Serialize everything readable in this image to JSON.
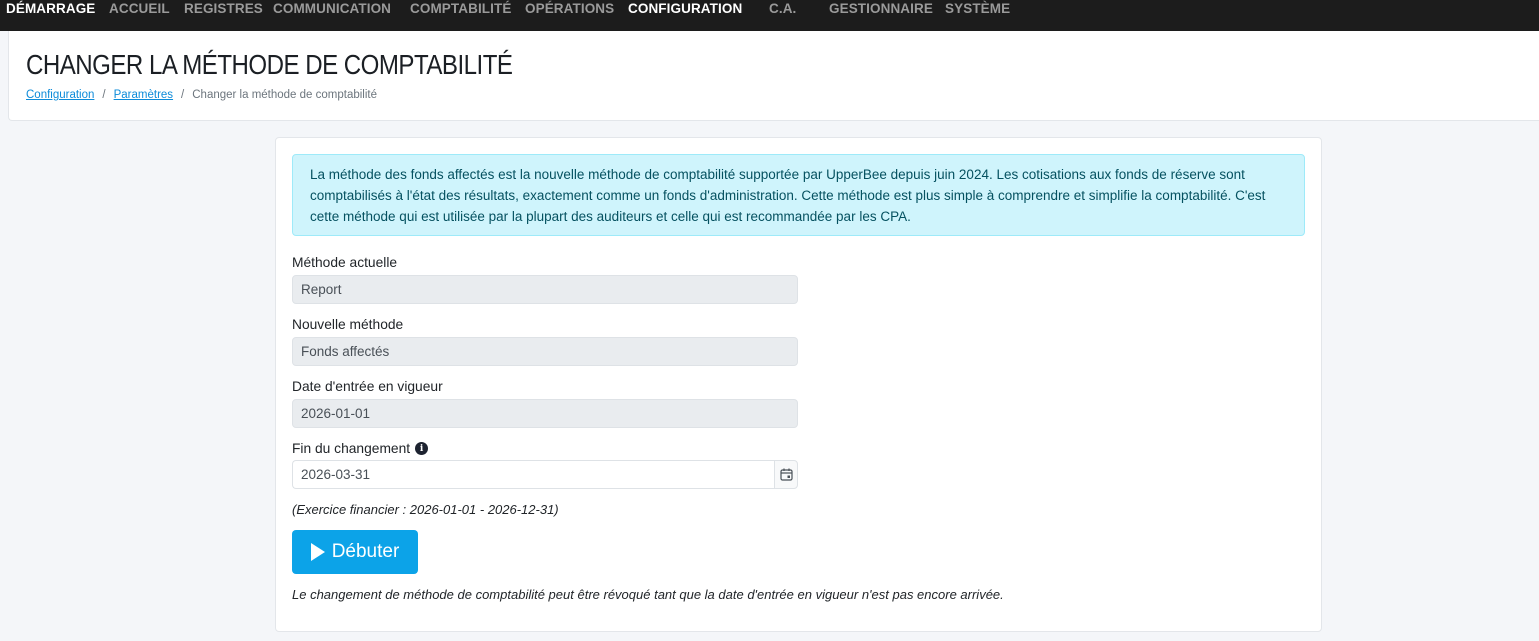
{
  "nav": {
    "items": [
      {
        "label": "DÉMARRAGE",
        "active": true
      },
      {
        "label": "ACCUEIL",
        "active": false
      },
      {
        "label": "REGISTRES",
        "active": false
      },
      {
        "label": "COMMUNICATION",
        "active": false
      },
      {
        "label": "COMPTABILITÉ",
        "active": false
      },
      {
        "label": "OPÉRATIONS",
        "active": false
      },
      {
        "label": "CONFIGURATION",
        "active": true
      },
      {
        "label": "C.A.",
        "active": false
      },
      {
        "label": "GESTIONNAIRE",
        "active": false
      },
      {
        "label": "SYSTÈME",
        "active": false
      }
    ]
  },
  "header": {
    "title": "CHANGER LA MÉTHODE DE COMPTABILITÉ",
    "breadcrumb": {
      "link1": "Configuration",
      "link2": "Paramètres",
      "current": "Changer la méthode de comptabilité",
      "separator": "/"
    }
  },
  "form": {
    "info_text": "La méthode des fonds affectés est la nouvelle méthode de comptabilité supportée par UpperBee depuis juin 2024. Les cotisations aux fonds de réserve sont comptabilisés à l'état des résultats, exactement comme un fonds d'administration. Cette méthode est plus simple à comprendre et simplifie la comptabilité. C'est cette méthode qui est utilisée par la plupart des auditeurs et celle qui est recommandée par les CPA.",
    "current_method_label": "Méthode actuelle",
    "current_method_value": "Report",
    "new_method_label": "Nouvelle méthode",
    "new_method_value": "Fonds affectés",
    "effective_date_label": "Date d'entrée en vigueur",
    "effective_date_value": "2026-01-01",
    "end_change_label": "Fin du changement",
    "end_change_value": "2026-03-31",
    "exercise_note": "(Exercice financier : 2026-01-01 - 2026-12-31)",
    "start_button_label": "Débuter",
    "revoke_note": "Le changement de méthode de comptabilité peut être révoqué tant que la date d'entrée en vigueur n'est pas encore arrivée."
  },
  "colors": {
    "nav_bg": "#1c1c1c",
    "accent": "#0ca3e8",
    "info_bg": "#cff4fc",
    "info_text": "#055160"
  },
  "icons": {
    "info": "info-circle-icon",
    "calendar": "calendar-icon",
    "play": "play-icon"
  }
}
